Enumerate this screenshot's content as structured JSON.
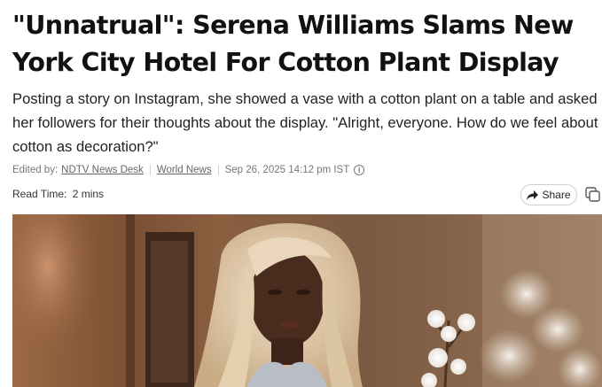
{
  "article": {
    "headline": "\"Unnatrual\": Serena Williams Slams New York City Hotel For Cotton Plant Display",
    "summary": "Posting a story on Instagram, she showed a vase with a cotton plant on a table and asked her followers for their thoughts about the display. \"Alright, everyone. How do we feel about cotton as decoration?\""
  },
  "meta": {
    "edited_by_label": "Edited by:",
    "author": "NDTV News Desk",
    "category": "World News",
    "date": "Sep 26, 2025 14:12 pm IST",
    "info_icon": "info-icon"
  },
  "read_time": {
    "label": "Read Time:",
    "value": "2 mins"
  },
  "actions": {
    "share_label": "Share",
    "share_icon": "share-arrow-icon",
    "copy_icon": "copy-icon"
  },
  "colors": {
    "text": "#111111",
    "meta_text": "#777777",
    "border": "#cfcfcf"
  }
}
